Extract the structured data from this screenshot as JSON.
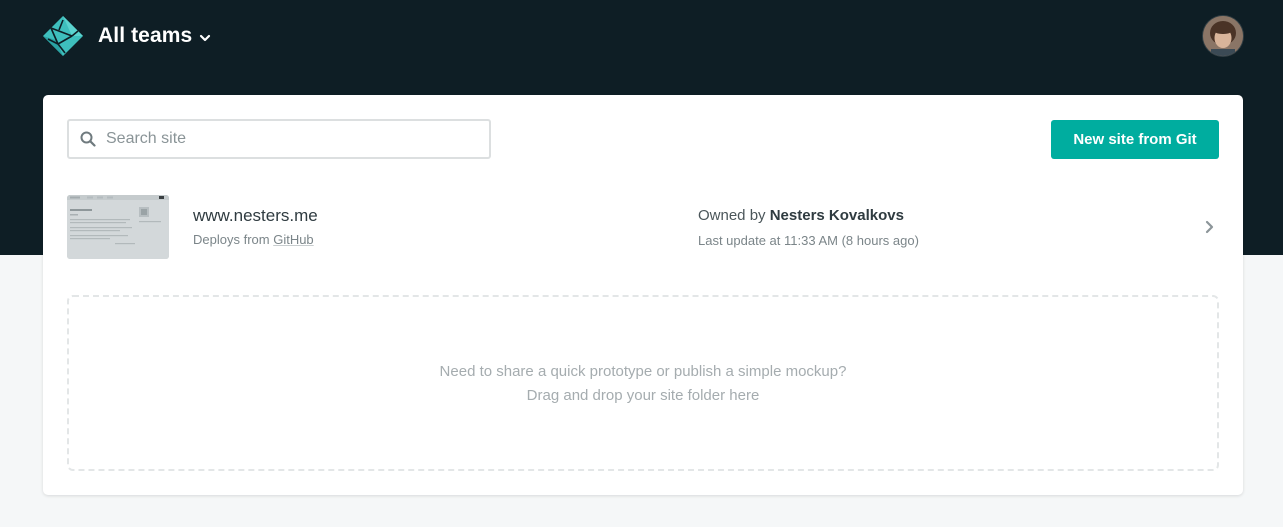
{
  "header": {
    "team_name": "All teams",
    "colors": {
      "background": "#0e1e25",
      "logo": "#3ebfbd"
    }
  },
  "search": {
    "placeholder": "Search site",
    "value": ""
  },
  "actions": {
    "new_site_label": "New site from Git",
    "accent_color": "#00ad9f"
  },
  "sites": [
    {
      "name": "www.nesters.me",
      "deploy_prefix": "Deploys from",
      "deploy_source": "GitHub",
      "owner_prefix": "Owned by",
      "owner_name": "Nesters Kovalkovs",
      "last_update": "Last update at 11:33 AM (8 hours ago)"
    }
  ],
  "drop_zone": {
    "line1": "Need to share a quick prototype or publish a simple mockup?",
    "line2": "Drag and drop your site folder here"
  },
  "icons": [
    "netlify-logo-icon",
    "chevron-down-icon",
    "search-icon",
    "chevron-right-icon"
  ]
}
